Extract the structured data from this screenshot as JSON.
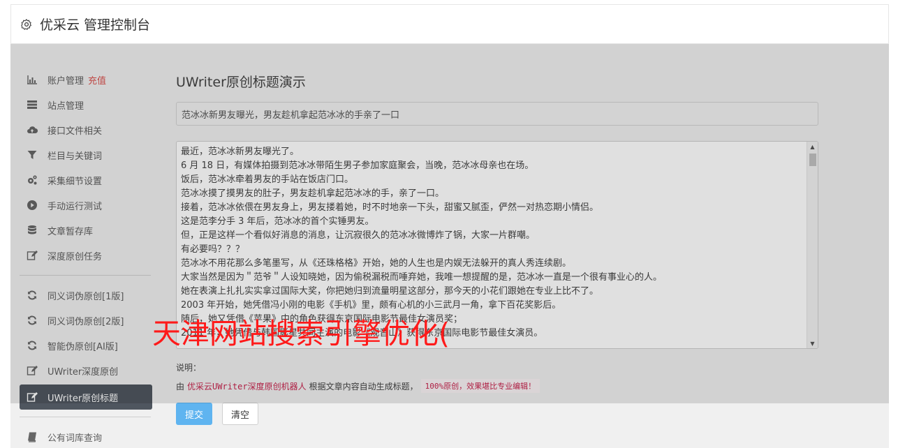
{
  "header": {
    "title": "优采云 管理控制台",
    "icon": "gear-icon"
  },
  "sidebar": {
    "items": [
      {
        "label": "账户管理",
        "badge": "充值",
        "icon": "bar-chart-icon"
      },
      {
        "label": "站点管理",
        "icon": "server-icon"
      },
      {
        "label": "接口文件相关",
        "icon": "cloud-upload-icon"
      },
      {
        "label": "栏目与关键词",
        "icon": "filter-icon"
      },
      {
        "label": "采集细节设置",
        "icon": "cogs-icon"
      },
      {
        "label": "手动运行测试",
        "icon": "play-icon"
      },
      {
        "label": "文章暂存库",
        "icon": "database-icon"
      },
      {
        "label": "深度原创任务",
        "icon": "edit-icon"
      },
      {
        "label": "同义词伪原创[1版]",
        "icon": "refresh-icon"
      },
      {
        "label": "同义词伪原创[2版]",
        "icon": "refresh-icon"
      },
      {
        "label": "智能伪原创[AI版]",
        "icon": "refresh-icon"
      },
      {
        "label": "UWriter深度原创",
        "icon": "edit-icon"
      },
      {
        "label": "UWriter原创标题",
        "icon": "edit-icon",
        "active": true
      },
      {
        "label": "公有词库查询",
        "icon": "book-icon"
      }
    ]
  },
  "main": {
    "heading": "UWriter原创标题演示",
    "title_value": "范冰冰新男友曝光，男友趁机拿起范冰冰的手亲了一口",
    "body_lines": [
      "最近，范冰冰新男友曝光了。",
      "6 月 18 日，有媒体拍摄到范冰冰带陌生男子参加家庭聚会，当晚，范冰冰母亲也在场。",
      "饭后，范冰冰牵着男友的手站在饭店门口。",
      "范冰冰摸了摸男友的肚子，男友趁机拿起范冰冰的手，亲了一口。",
      "接着，范冰冰依偎在男友身上，男友搂着她，时不时地亲一下头，甜蜜又腻歪，俨然一对热恋期小情侣。",
      "这是范李分手 3 年后，范冰冰的首个实锤男友。",
      "但，正是这样一个看似好消息的消息，让沉寂很久的范冰冰微博炸了锅，大家一片群嘲。",
      "有必要吗？？？",
      "范冰冰不用花那么多笔墨写，从《还珠格格》开始，她的人生也是内娱无法躲开的真人秀连续剧。",
      "大家当然是因为＂范爷＂人设知晓她，因为偷税漏税而唾弃她，我唯一想提醒的是，范冰冰一直是一个很有事业心的人。",
      "她在表演上扎扎实实拿过国际大奖，你把她归到流量明星这部分，那今天的小花们跟她在专业上比不了。",
      "2003 年开始，她凭借冯小刚的电影《手机》里，颇有心机的小三武月一角，拿下百花奖影后。",
      "随后，她又凭借《苹果》中的角色获得东京国际电影节最佳女演员奖；",
      "2011 年，她凭借与韩国影星共同主演的电影《观音山》获得东京国际电影节最佳女演员。"
    ],
    "note_label": "说明：",
    "note_prefix": "由",
    "note_robot": "优采云UWriter深度原创机器人",
    "note_middle": "根据文章内容自动生成标题，",
    "note_code": "100%原创，效果堪比专业编辑！"
  },
  "buttons": {
    "submit": "提交",
    "clear": "清空"
  },
  "watermark": "天津网站搜索引擎优化("
}
